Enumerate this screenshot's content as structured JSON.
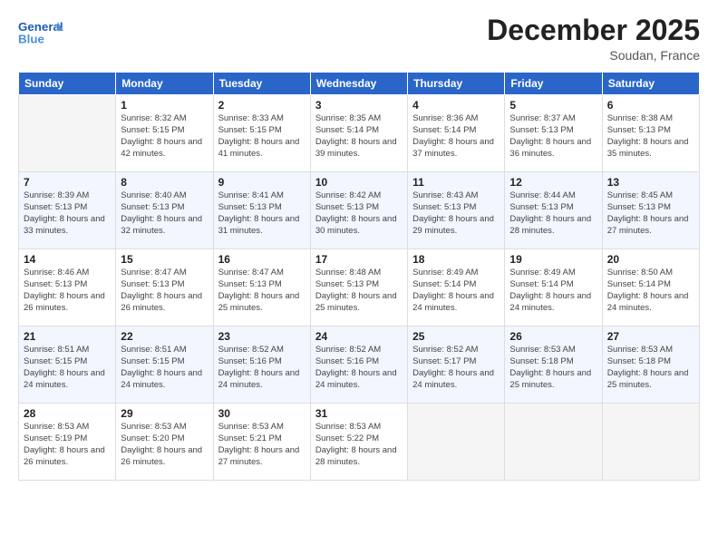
{
  "header": {
    "logo_general": "General",
    "logo_blue": "Blue",
    "title": "December 2025",
    "subtitle": "Soudan, France"
  },
  "days_of_week": [
    "Sunday",
    "Monday",
    "Tuesday",
    "Wednesday",
    "Thursday",
    "Friday",
    "Saturday"
  ],
  "weeks": [
    [
      {
        "day": "",
        "empty": true
      },
      {
        "day": "1",
        "sunrise": "Sunrise: 8:32 AM",
        "sunset": "Sunset: 5:15 PM",
        "daylight": "Daylight: 8 hours and 42 minutes."
      },
      {
        "day": "2",
        "sunrise": "Sunrise: 8:33 AM",
        "sunset": "Sunset: 5:15 PM",
        "daylight": "Daylight: 8 hours and 41 minutes."
      },
      {
        "day": "3",
        "sunrise": "Sunrise: 8:35 AM",
        "sunset": "Sunset: 5:14 PM",
        "daylight": "Daylight: 8 hours and 39 minutes."
      },
      {
        "day": "4",
        "sunrise": "Sunrise: 8:36 AM",
        "sunset": "Sunset: 5:14 PM",
        "daylight": "Daylight: 8 hours and 37 minutes."
      },
      {
        "day": "5",
        "sunrise": "Sunrise: 8:37 AM",
        "sunset": "Sunset: 5:13 PM",
        "daylight": "Daylight: 8 hours and 36 minutes."
      },
      {
        "day": "6",
        "sunrise": "Sunrise: 8:38 AM",
        "sunset": "Sunset: 5:13 PM",
        "daylight": "Daylight: 8 hours and 35 minutes."
      }
    ],
    [
      {
        "day": "7",
        "sunrise": "Sunrise: 8:39 AM",
        "sunset": "Sunset: 5:13 PM",
        "daylight": "Daylight: 8 hours and 33 minutes."
      },
      {
        "day": "8",
        "sunrise": "Sunrise: 8:40 AM",
        "sunset": "Sunset: 5:13 PM",
        "daylight": "Daylight: 8 hours and 32 minutes."
      },
      {
        "day": "9",
        "sunrise": "Sunrise: 8:41 AM",
        "sunset": "Sunset: 5:13 PM",
        "daylight": "Daylight: 8 hours and 31 minutes."
      },
      {
        "day": "10",
        "sunrise": "Sunrise: 8:42 AM",
        "sunset": "Sunset: 5:13 PM",
        "daylight": "Daylight: 8 hours and 30 minutes."
      },
      {
        "day": "11",
        "sunrise": "Sunrise: 8:43 AM",
        "sunset": "Sunset: 5:13 PM",
        "daylight": "Daylight: 8 hours and 29 minutes."
      },
      {
        "day": "12",
        "sunrise": "Sunrise: 8:44 AM",
        "sunset": "Sunset: 5:13 PM",
        "daylight": "Daylight: 8 hours and 28 minutes."
      },
      {
        "day": "13",
        "sunrise": "Sunrise: 8:45 AM",
        "sunset": "Sunset: 5:13 PM",
        "daylight": "Daylight: 8 hours and 27 minutes."
      }
    ],
    [
      {
        "day": "14",
        "sunrise": "Sunrise: 8:46 AM",
        "sunset": "Sunset: 5:13 PM",
        "daylight": "Daylight: 8 hours and 26 minutes."
      },
      {
        "day": "15",
        "sunrise": "Sunrise: 8:47 AM",
        "sunset": "Sunset: 5:13 PM",
        "daylight": "Daylight: 8 hours and 26 minutes."
      },
      {
        "day": "16",
        "sunrise": "Sunrise: 8:47 AM",
        "sunset": "Sunset: 5:13 PM",
        "daylight": "Daylight: 8 hours and 25 minutes."
      },
      {
        "day": "17",
        "sunrise": "Sunrise: 8:48 AM",
        "sunset": "Sunset: 5:13 PM",
        "daylight": "Daylight: 8 hours and 25 minutes."
      },
      {
        "day": "18",
        "sunrise": "Sunrise: 8:49 AM",
        "sunset": "Sunset: 5:14 PM",
        "daylight": "Daylight: 8 hours and 24 minutes."
      },
      {
        "day": "19",
        "sunrise": "Sunrise: 8:49 AM",
        "sunset": "Sunset: 5:14 PM",
        "daylight": "Daylight: 8 hours and 24 minutes."
      },
      {
        "day": "20",
        "sunrise": "Sunrise: 8:50 AM",
        "sunset": "Sunset: 5:14 PM",
        "daylight": "Daylight: 8 hours and 24 minutes."
      }
    ],
    [
      {
        "day": "21",
        "sunrise": "Sunrise: 8:51 AM",
        "sunset": "Sunset: 5:15 PM",
        "daylight": "Daylight: 8 hours and 24 minutes."
      },
      {
        "day": "22",
        "sunrise": "Sunrise: 8:51 AM",
        "sunset": "Sunset: 5:15 PM",
        "daylight": "Daylight: 8 hours and 24 minutes."
      },
      {
        "day": "23",
        "sunrise": "Sunrise: 8:52 AM",
        "sunset": "Sunset: 5:16 PM",
        "daylight": "Daylight: 8 hours and 24 minutes."
      },
      {
        "day": "24",
        "sunrise": "Sunrise: 8:52 AM",
        "sunset": "Sunset: 5:16 PM",
        "daylight": "Daylight: 8 hours and 24 minutes."
      },
      {
        "day": "25",
        "sunrise": "Sunrise: 8:52 AM",
        "sunset": "Sunset: 5:17 PM",
        "daylight": "Daylight: 8 hours and 24 minutes."
      },
      {
        "day": "26",
        "sunrise": "Sunrise: 8:53 AM",
        "sunset": "Sunset: 5:18 PM",
        "daylight": "Daylight: 8 hours and 25 minutes."
      },
      {
        "day": "27",
        "sunrise": "Sunrise: 8:53 AM",
        "sunset": "Sunset: 5:18 PM",
        "daylight": "Daylight: 8 hours and 25 minutes."
      }
    ],
    [
      {
        "day": "28",
        "sunrise": "Sunrise: 8:53 AM",
        "sunset": "Sunset: 5:19 PM",
        "daylight": "Daylight: 8 hours and 26 minutes."
      },
      {
        "day": "29",
        "sunrise": "Sunrise: 8:53 AM",
        "sunset": "Sunset: 5:20 PM",
        "daylight": "Daylight: 8 hours and 26 minutes."
      },
      {
        "day": "30",
        "sunrise": "Sunrise: 8:53 AM",
        "sunset": "Sunset: 5:21 PM",
        "daylight": "Daylight: 8 hours and 27 minutes."
      },
      {
        "day": "31",
        "sunrise": "Sunrise: 8:53 AM",
        "sunset": "Sunset: 5:22 PM",
        "daylight": "Daylight: 8 hours and 28 minutes."
      },
      {
        "day": "",
        "empty": true
      },
      {
        "day": "",
        "empty": true
      },
      {
        "day": "",
        "empty": true
      }
    ]
  ]
}
